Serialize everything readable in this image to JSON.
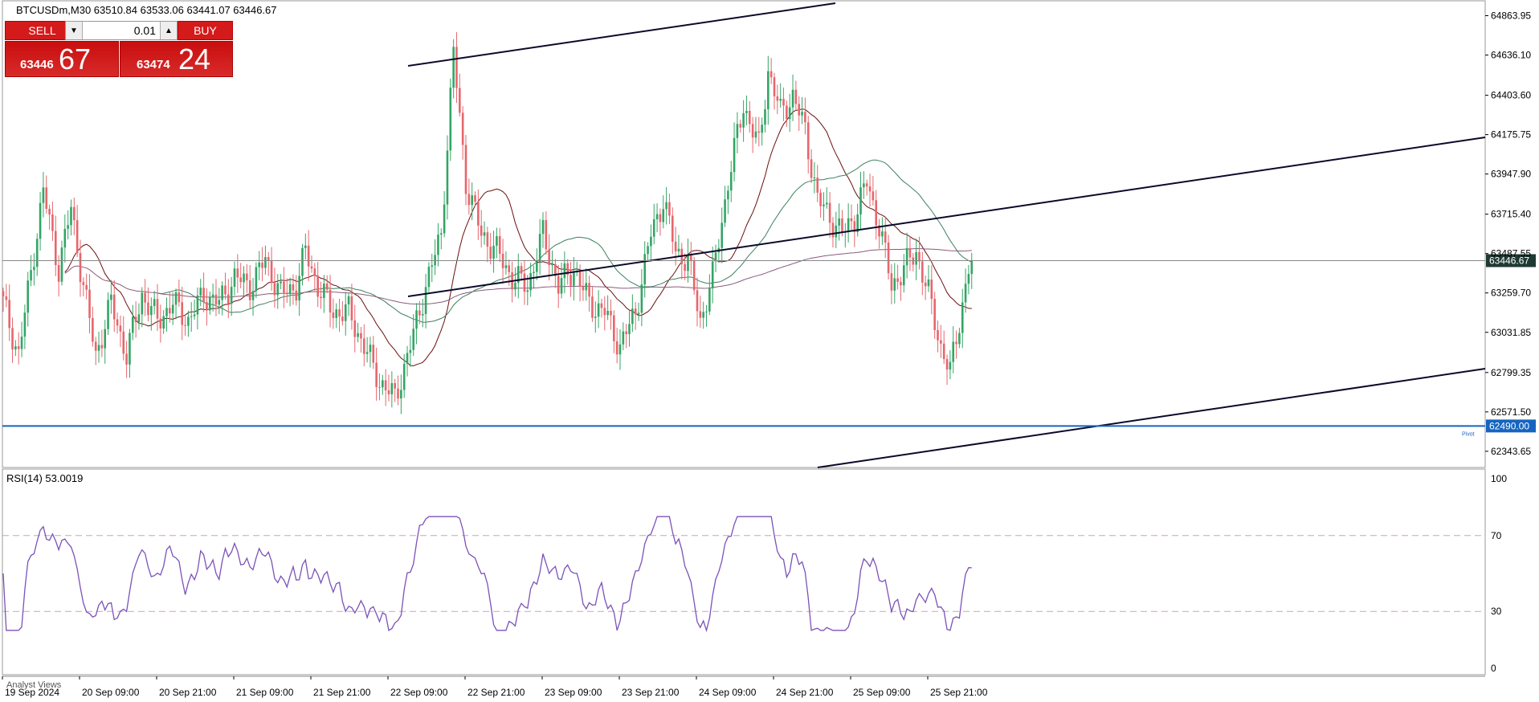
{
  "header": {
    "symbol_line": "BTCUSDm,M30   63510.84 63533.06 63441.07 63446.67",
    "rsi_label": "RSI(14) 53.0019"
  },
  "trade_panel": {
    "sell_label": "SELL",
    "buy_label": "BUY",
    "lot": "0.01",
    "sell_price_small": "63446",
    "sell_price_big": "67",
    "buy_price_small": "63474",
    "buy_price_big": "24"
  },
  "footer": {
    "analyst_views": "Analyst Views"
  },
  "colors": {
    "bull": "#33a565",
    "bear": "#e6666d",
    "rsi_line": "#7b52b8",
    "ma_dark_red": "#6b0f0f",
    "ma_green": "#3d7f5f",
    "ma_purple": "#8a5a7c",
    "pivot_blue": "#1565c0",
    "channel": "#0a0a2a"
  },
  "chart_data": [
    {
      "type": "candlestick",
      "symbol": "BTCUSDm",
      "timeframe": "M30",
      "ylim": [
        62250,
        64950
      ],
      "y_ticks": [
        "64863.95",
        "64636.10",
        "64403.60",
        "64175.75",
        "63947.90",
        "63715.40",
        "63487.55",
        "63259.70",
        "63031.85",
        "62799.35",
        "62571.50",
        "62343.65"
      ],
      "x_ticks": [
        "19 Sep 2024",
        "20 Sep 09:00",
        "20 Sep 21:00",
        "21 Sep 09:00",
        "21 Sep 21:00",
        "22 Sep 09:00",
        "22 Sep 21:00",
        "23 Sep 09:00",
        "23 Sep 21:00",
        "24 Sep 09:00",
        "24 Sep 21:00",
        "25 Sep 09:00",
        "25 Sep 21:00"
      ],
      "anchors": [
        [
          0,
          63200
        ],
        [
          5,
          62900
        ],
        [
          10,
          63500
        ],
        [
          13,
          63850
        ],
        [
          18,
          63400
        ],
        [
          22,
          63750
        ],
        [
          26,
          63300
        ],
        [
          30,
          62900
        ],
        [
          35,
          63200
        ],
        [
          40,
          62900
        ],
        [
          45,
          63250
        ],
        [
          50,
          63100
        ],
        [
          55,
          63200
        ],
        [
          60,
          63100
        ],
        [
          65,
          63250
        ],
        [
          70,
          63200
        ],
        [
          75,
          63350
        ],
        [
          80,
          63300
        ],
        [
          85,
          63450
        ],
        [
          90,
          63250
        ],
        [
          95,
          63300
        ],
        [
          98,
          63500
        ],
        [
          102,
          63300
        ],
        [
          107,
          63150
        ],
        [
          112,
          63150
        ],
        [
          117,
          62950
        ],
        [
          122,
          62750
        ],
        [
          127,
          62650
        ],
        [
          132,
          62950
        ],
        [
          137,
          63300
        ],
        [
          142,
          63600
        ],
        [
          146,
          64650
        ],
        [
          150,
          63900
        ],
        [
          155,
          63600
        ],
        [
          160,
          63500
        ],
        [
          165,
          63350
        ],
        [
          170,
          63300
        ],
        [
          175,
          63600
        ],
        [
          180,
          63300
        ],
        [
          185,
          63400
        ],
        [
          190,
          63200
        ],
        [
          195,
          63150
        ],
        [
          200,
          62950
        ],
        [
          205,
          63150
        ],
        [
          210,
          63600
        ],
        [
          214,
          63800
        ],
        [
          218,
          63500
        ],
        [
          222,
          63450
        ],
        [
          226,
          63100
        ],
        [
          230,
          63350
        ],
        [
          235,
          63900
        ],
        [
          240,
          64350
        ],
        [
          245,
          64100
        ],
        [
          248,
          64550
        ],
        [
          252,
          64300
        ],
        [
          256,
          64400
        ],
        [
          260,
          64200
        ],
        [
          264,
          63800
        ],
        [
          268,
          63700
        ],
        [
          272,
          63600
        ],
        [
          276,
          63700
        ],
        [
          280,
          63900
        ],
        [
          284,
          63650
        ],
        [
          288,
          63300
        ],
        [
          292,
          63400
        ],
        [
          296,
          63500
        ],
        [
          300,
          63250
        ],
        [
          304,
          62950
        ],
        [
          307,
          62800
        ],
        [
          310,
          63100
        ],
        [
          314,
          63500
        ]
      ],
      "last_price": 63446.67,
      "last_price_label": "63446.67",
      "pivot": {
        "value": 62490.0,
        "label": "62490.00",
        "text": "Pivot"
      },
      "moving_averages": [
        "short (dark red)",
        "medium (green)",
        "long (purple)"
      ]
    },
    {
      "type": "line",
      "indicator": "RSI(14)",
      "value": 53.0019,
      "ylim": [
        0,
        100
      ],
      "y_ticks": [
        "100",
        "70",
        "30",
        "0"
      ],
      "levels": [
        70,
        30
      ]
    }
  ]
}
